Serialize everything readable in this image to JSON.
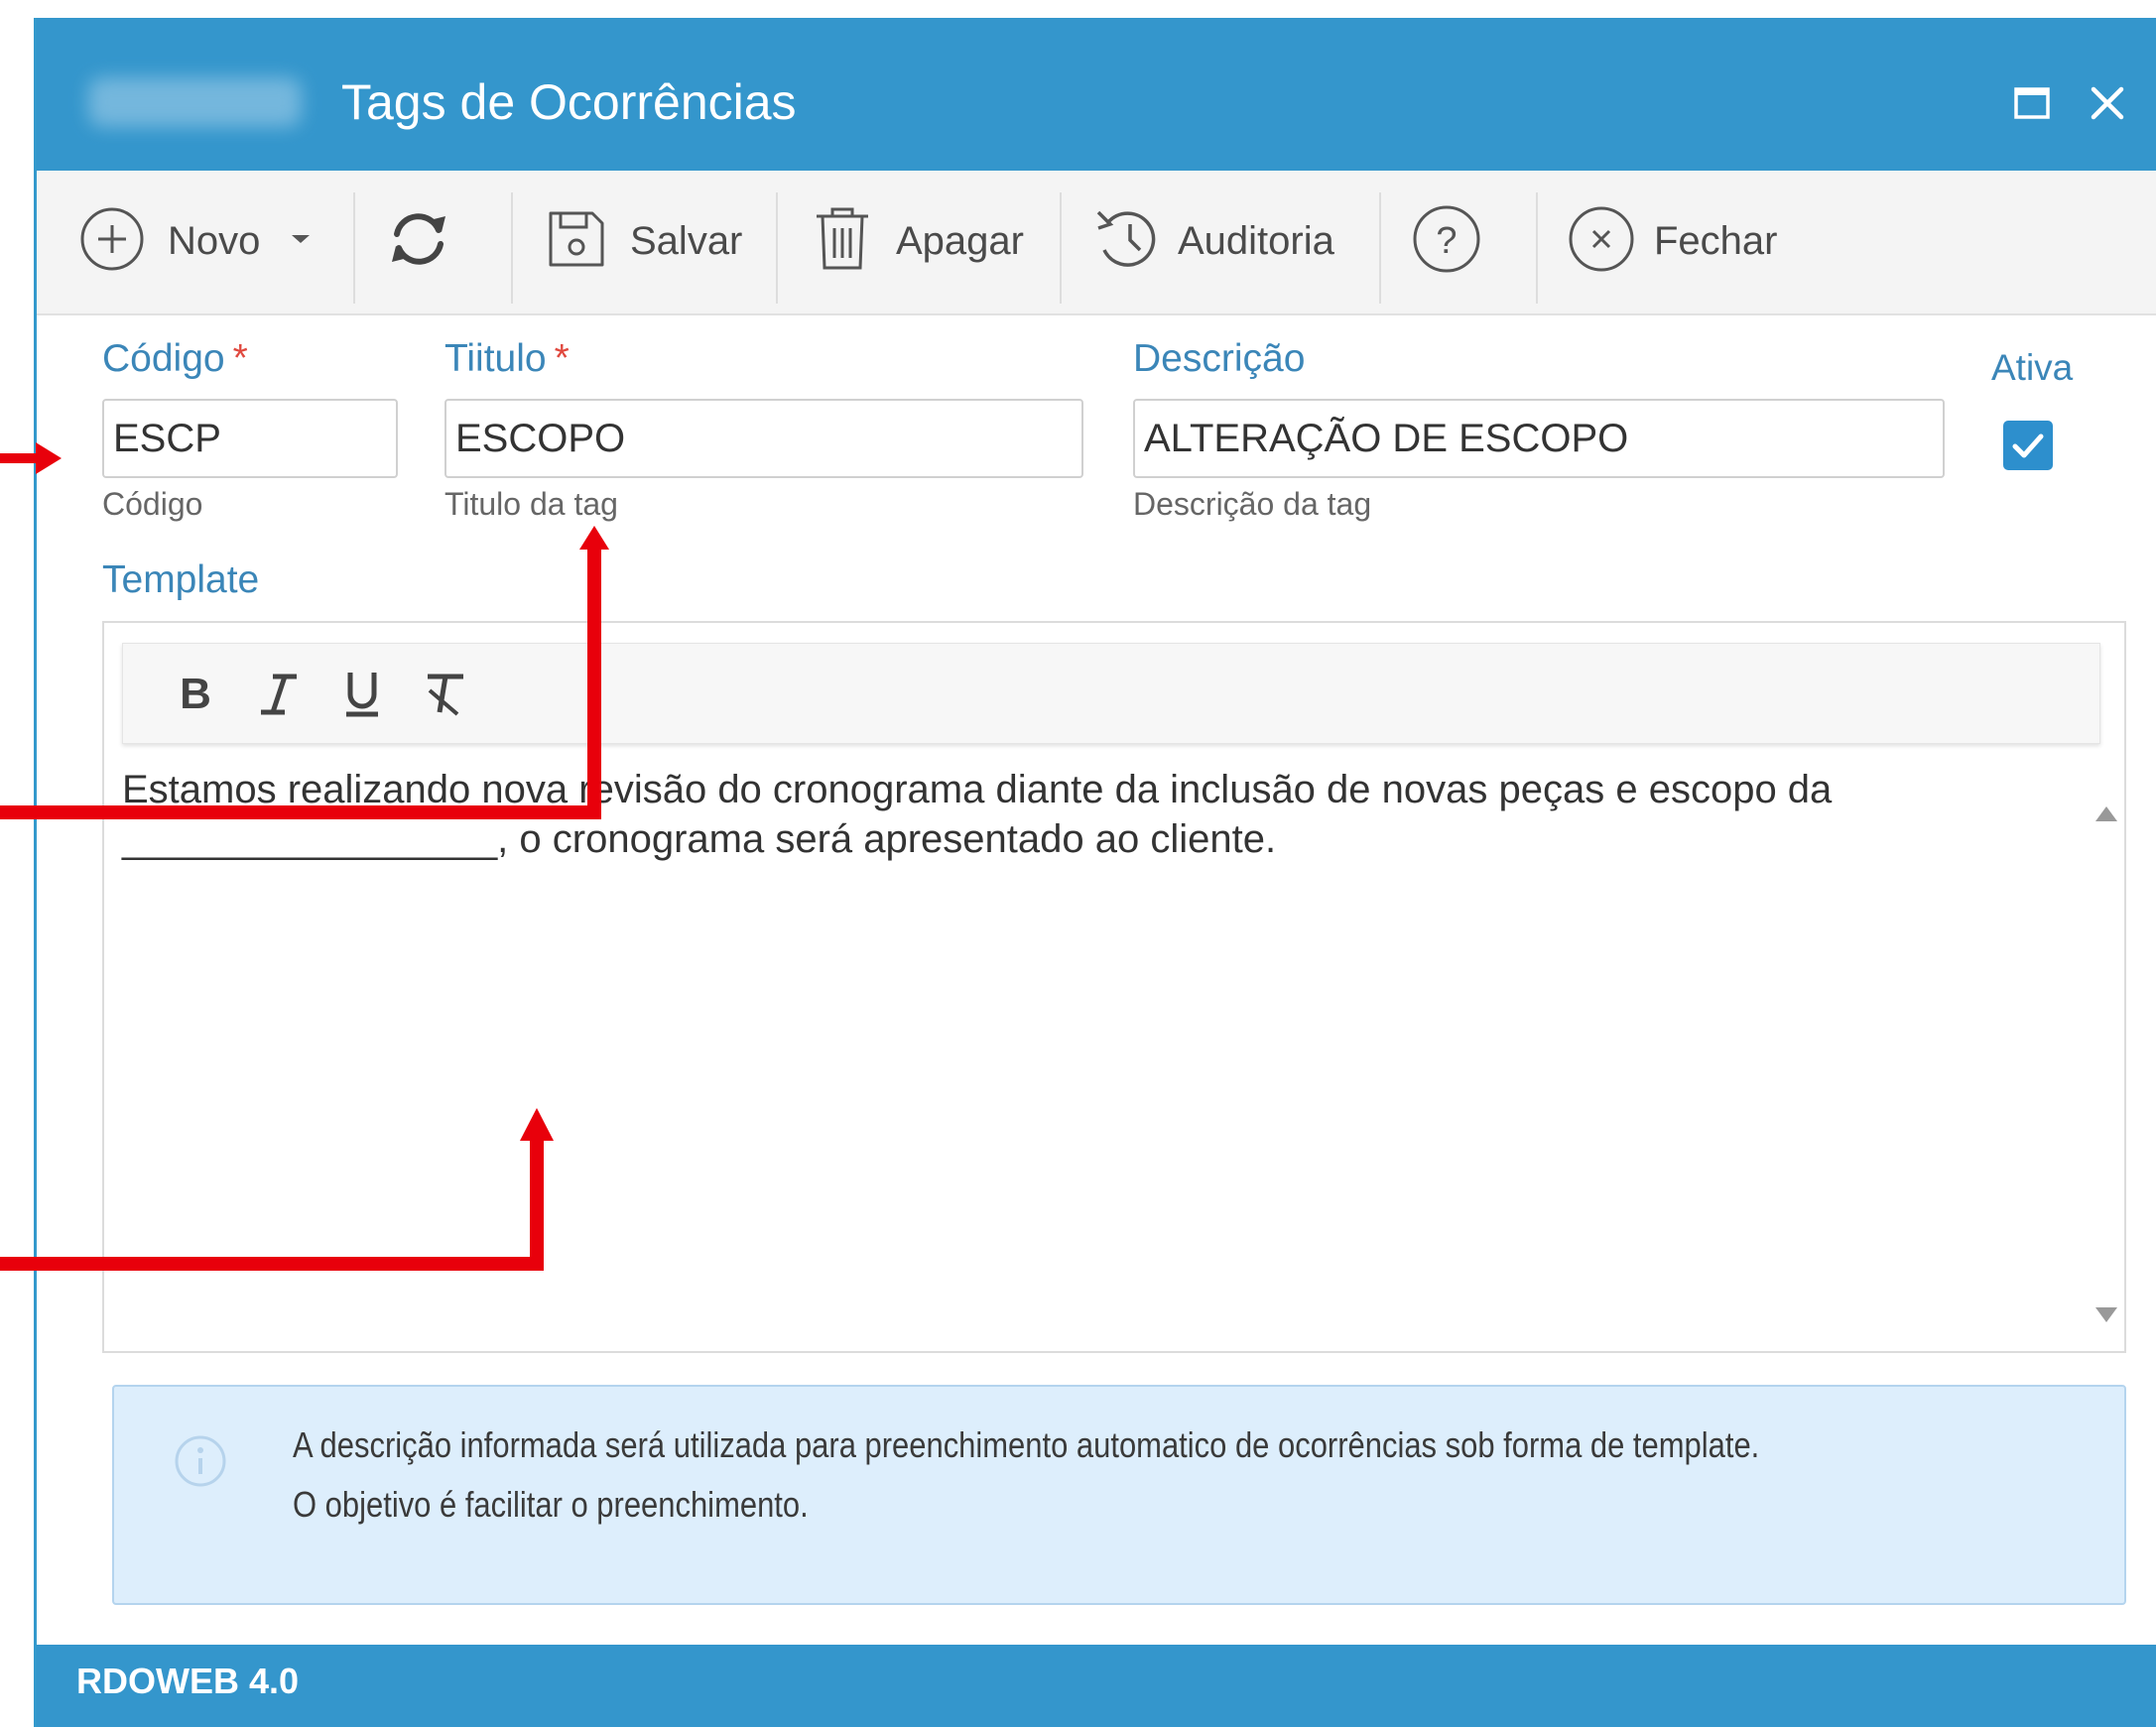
{
  "window": {
    "title": "Tags de Ocorrências",
    "accent_color": "#3496cc"
  },
  "toolbar": {
    "new_label": "Novo",
    "save_label": "Salvar",
    "delete_label": "Apagar",
    "audit_label": "Auditoria",
    "close_label": "Fechar"
  },
  "form": {
    "codigo": {
      "label": "Código",
      "required_mark": "*",
      "value": "ESCP",
      "hint": "Código"
    },
    "titulo": {
      "label": "Tiitulo",
      "required_mark": "*",
      "value": "ESCOPO",
      "hint": "Titulo da tag"
    },
    "descricao": {
      "label": "Descrição",
      "value": "ALTERAÇÃO DE ESCOPO",
      "hint": "Descrição da tag"
    },
    "ativa": {
      "label": "Ativa",
      "checked": true
    }
  },
  "template": {
    "label": "Template",
    "toolbar": [
      "bold",
      "italic",
      "underline",
      "clear-format"
    ],
    "line1": "Estamos realizando nova revisão do cronograma diante da inclusão de novas peças e escopo da",
    "line2": "_________________, o cronograma será apresentado ao cliente."
  },
  "info": {
    "line1": "A descrição informada será utilizada para preenchimento automatico de ocorrências sob forma de template.",
    "line2": "O objetivo é facilitar o preenchimento."
  },
  "footer": {
    "text": "RDOWEB 4.0"
  },
  "annotation_color": "#e8000b"
}
